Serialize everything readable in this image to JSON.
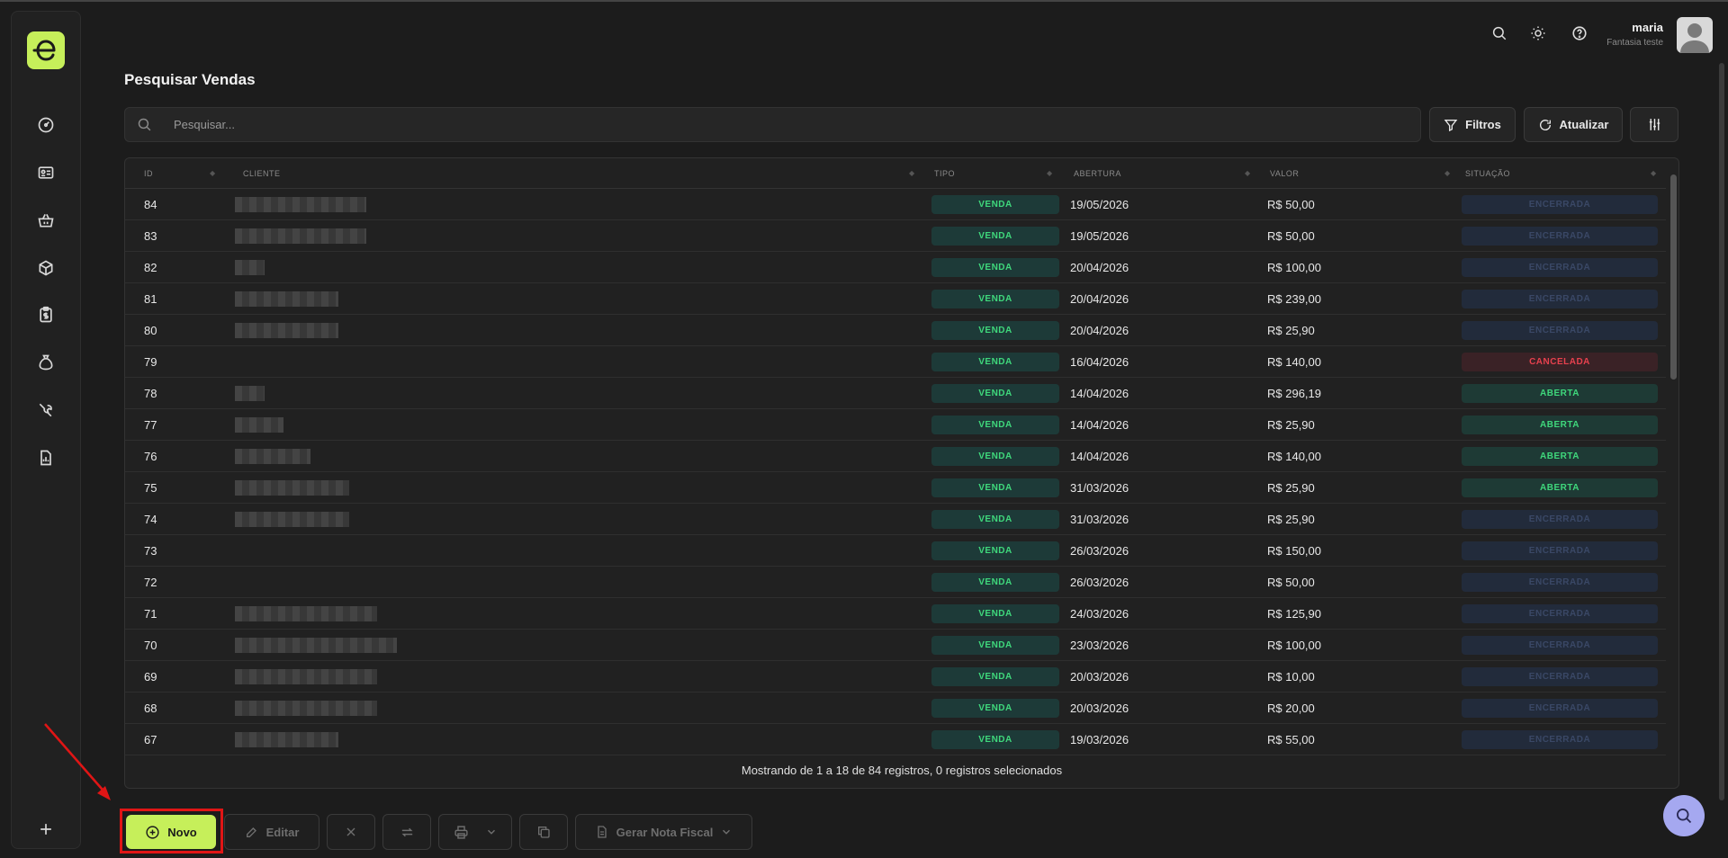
{
  "user": {
    "name": "maria",
    "company": "Fantasia teste"
  },
  "page": {
    "title": "Pesquisar Vendas"
  },
  "search": {
    "placeholder": "Pesquisar..."
  },
  "toolbar": {
    "filters_label": "Filtros",
    "refresh_label": "Atualizar"
  },
  "table": {
    "columns": [
      "ID",
      "CLIENTE",
      "TIPO",
      "ABERTURA",
      "VALOR",
      "SITUAÇÃO"
    ],
    "rows": [
      {
        "id": "84",
        "tipo": "VENDA",
        "abertura": "19/05/2026",
        "valor": "R$ 50,00",
        "situacao": "ENCERRADA"
      },
      {
        "id": "83",
        "tipo": "VENDA",
        "abertura": "19/05/2026",
        "valor": "R$ 50,00",
        "situacao": "ENCERRADA"
      },
      {
        "id": "82",
        "tipo": "VENDA",
        "abertura": "20/04/2026",
        "valor": "R$ 100,00",
        "situacao": "ENCERRADA"
      },
      {
        "id": "81",
        "tipo": "VENDA",
        "abertura": "20/04/2026",
        "valor": "R$ 239,00",
        "situacao": "ENCERRADA"
      },
      {
        "id": "80",
        "tipo": "VENDA",
        "abertura": "20/04/2026",
        "valor": "R$ 25,90",
        "situacao": "ENCERRADA"
      },
      {
        "id": "79",
        "tipo": "VENDA",
        "abertura": "16/04/2026",
        "valor": "R$ 140,00",
        "situacao": "CANCELADA"
      },
      {
        "id": "78",
        "tipo": "VENDA",
        "abertura": "14/04/2026",
        "valor": "R$ 296,19",
        "situacao": "ABERTA"
      },
      {
        "id": "77",
        "tipo": "VENDA",
        "abertura": "14/04/2026",
        "valor": "R$ 25,90",
        "situacao": "ABERTA"
      },
      {
        "id": "76",
        "tipo": "VENDA",
        "abertura": "14/04/2026",
        "valor": "R$ 140,00",
        "situacao": "ABERTA"
      },
      {
        "id": "75",
        "tipo": "VENDA",
        "abertura": "31/03/2026",
        "valor": "R$ 25,90",
        "situacao": "ABERTA"
      },
      {
        "id": "74",
        "tipo": "VENDA",
        "abertura": "31/03/2026",
        "valor": "R$ 25,90",
        "situacao": "ENCERRADA"
      },
      {
        "id": "73",
        "tipo": "VENDA",
        "abertura": "26/03/2026",
        "valor": "R$ 150,00",
        "situacao": "ENCERRADA"
      },
      {
        "id": "72",
        "tipo": "VENDA",
        "abertura": "26/03/2026",
        "valor": "R$ 50,00",
        "situacao": "ENCERRADA"
      },
      {
        "id": "71",
        "tipo": "VENDA",
        "abertura": "24/03/2026",
        "valor": "R$ 125,90",
        "situacao": "ENCERRADA"
      },
      {
        "id": "70",
        "tipo": "VENDA",
        "abertura": "23/03/2026",
        "valor": "R$ 100,00",
        "situacao": "ENCERRADA"
      },
      {
        "id": "69",
        "tipo": "VENDA",
        "abertura": "20/03/2026",
        "valor": "R$ 10,00",
        "situacao": "ENCERRADA"
      },
      {
        "id": "68",
        "tipo": "VENDA",
        "abertura": "20/03/2026",
        "valor": "R$ 20,00",
        "situacao": "ENCERRADA"
      },
      {
        "id": "67",
        "tipo": "VENDA",
        "abertura": "19/03/2026",
        "valor": "R$ 55,00",
        "situacao": "ENCERRADA"
      }
    ],
    "footer": "Mostrando de 1 a 18 de 84 registros, 0 registros selecionados"
  },
  "actions": {
    "novo_label": "Novo",
    "editar_label": "Editar",
    "nota_fiscal_label": "Gerar Nota Fiscal"
  },
  "colors": {
    "accent": "#c6ef5a",
    "aberta": "#3fd87c",
    "cancelada": "#e8414e",
    "encerrada": "#3a4866"
  }
}
